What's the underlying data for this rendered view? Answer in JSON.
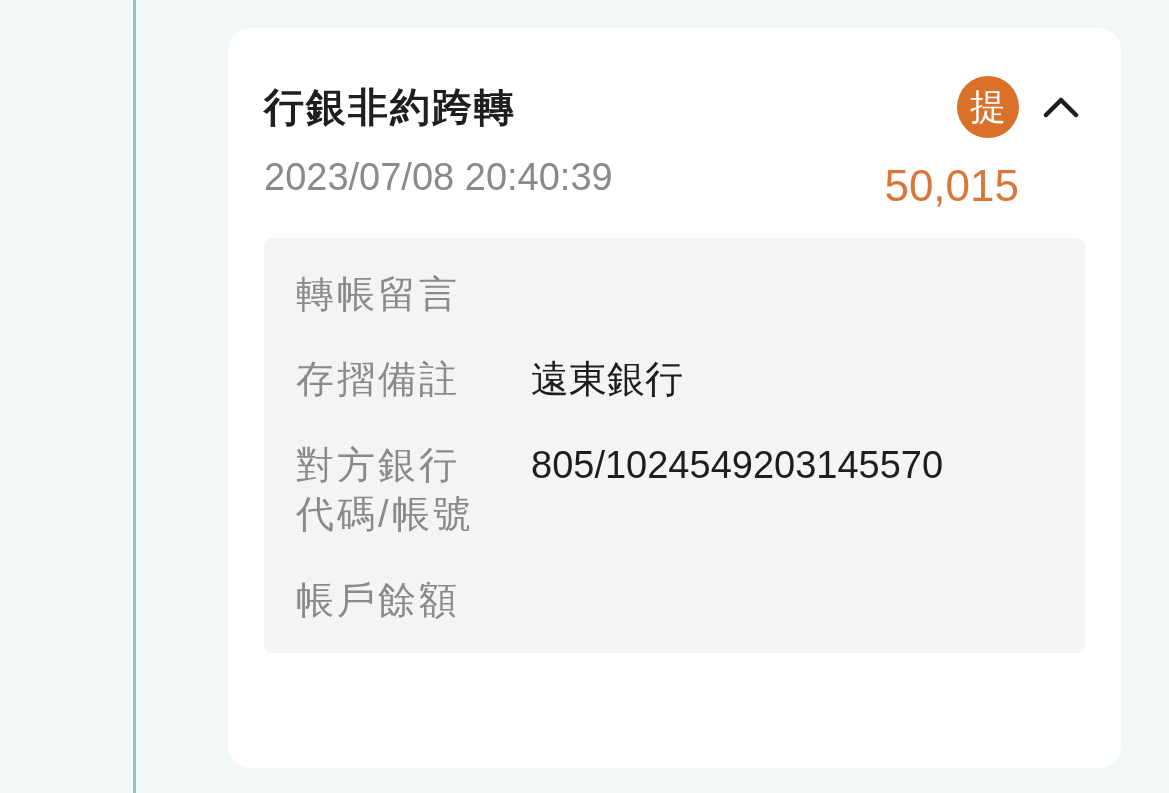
{
  "card": {
    "title": "行銀非約跨轉",
    "badge": "提",
    "expanded": true,
    "date": "2023/07/08 20:40:39",
    "amount": "50,015",
    "details": [
      {
        "label": "轉帳留言"
      },
      {
        "label": "存摺備註",
        "value": "遠東銀行"
      },
      {
        "label": "對方銀行代碼/帳號",
        "value": "805/1024549203145570"
      },
      {
        "label": "帳戶餘額"
      }
    ]
  }
}
